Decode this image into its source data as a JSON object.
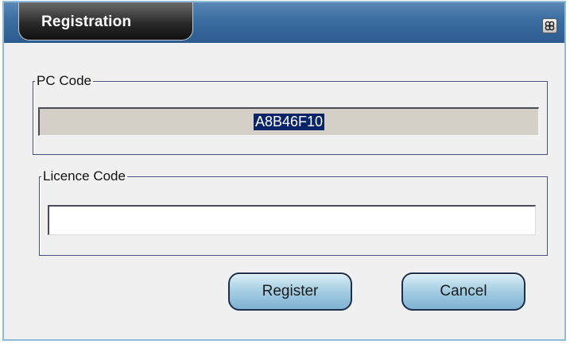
{
  "window": {
    "title": "Registration",
    "close_icon": "close-icon"
  },
  "pc_code": {
    "label": "PC Code",
    "value": "A8B46F10"
  },
  "licence_code": {
    "label": "Licence Code",
    "value": "",
    "placeholder": ""
  },
  "buttons": {
    "register": "Register",
    "cancel": "Cancel"
  },
  "colors": {
    "title_bar": "#3d6fa3",
    "title_tab": "#2a2a2a",
    "button_face": "#a3cce2",
    "selection": "#0a246a",
    "readonly_field": "#d4d0c8"
  }
}
